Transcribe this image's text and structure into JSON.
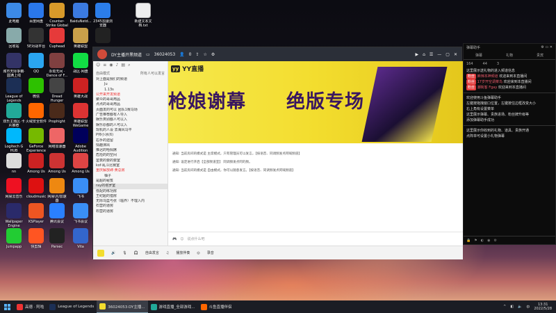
{
  "desktop": {
    "icons": [
      {
        "label": "此电脑",
        "color": "#3c8ae6"
      },
      {
        "label": "百度网盘",
        "color": "#2a77ea"
      },
      {
        "label": "Counter-Strike Global Off...",
        "color": "#d89a2a"
      },
      {
        "label": "BaiduNetd...",
        "color": "#3b7ae0"
      },
      {
        "label": "2345加速浏览器",
        "color": "#2b7de9"
      },
      {
        "label": "回收站",
        "color": "#8aa"
      },
      {
        "label": "5E对战平台",
        "color": "#333"
      },
      {
        "label": "Cuphead",
        "color": "#e63a3a"
      },
      {
        "label": "英雄联盟",
        "color": "#c9a04a"
      },
      {
        "label": "",
        "color": "#222"
      },
      {
        "label": "城市天际争霸·圆满上线",
        "color": "#336"
      },
      {
        "label": "QQ",
        "color": "#2aa5f0"
      },
      {
        "label": "永劫无间 · Dance of F...",
        "color": "#804040"
      },
      {
        "label": "战区·网盘",
        "color": "#1d4"
      },
      {
        "label": "",
        "color": "#666"
      },
      {
        "label": "League of Legends",
        "color": "#1c2f55"
      },
      {
        "label": "微信",
        "color": "#2dc100"
      },
      {
        "label": "Dread Hunger",
        "color": "#444"
      },
      {
        "label": "英雄大战",
        "color": "#c22"
      },
      {
        "label": "",
        "color": "#999"
      },
      {
        "label": "双乐主题区·卡片推荐",
        "color": "#2a9"
      },
      {
        "label": "火绒安全软件",
        "color": "#f60"
      },
      {
        "label": "Prophight",
        "color": "#4a2a1a"
      },
      {
        "label": "英雄联盟WeGame",
        "color": "#d33"
      },
      {
        "label": "",
        "color": "#555"
      },
      {
        "label": "Logitech G HUB",
        "color": "#00b8fc"
      },
      {
        "label": "GeForce Experience",
        "color": "#76b900"
      },
      {
        "label": "网络加速器",
        "color": "#e66"
      },
      {
        "label": "Adobe Audition",
        "color": "#00005b"
      },
      {
        "label": "",
        "color": "#444"
      },
      {
        "label": "nn",
        "color": "#ddd"
      },
      {
        "label": "Among Us",
        "color": "#c22"
      },
      {
        "label": "Among Us",
        "color": "#c33"
      },
      {
        "label": "Among Us",
        "color": "#d44"
      },
      {
        "label": "Among Us",
        "color": "#333"
      },
      {
        "label": "网易云音乐",
        "color": "#e12"
      },
      {
        "label": "cloudmusic",
        "color": "#d11"
      },
      {
        "label": "网易UU加速器",
        "color": "#e81"
      },
      {
        "label": "飞书",
        "color": "#3a8ef6"
      },
      {
        "label": "WPS表格",
        "color": "#2db34a"
      },
      {
        "label": "Wallpaper Engine",
        "color": "#2a2a6a"
      },
      {
        "label": "KSPlayer",
        "color": "#e52"
      },
      {
        "label": "腾讯会议",
        "color": "#2a80ff"
      },
      {
        "label": "飞书会议",
        "color": "#3a8ef6"
      },
      {
        "label": "WPS Office",
        "color": "#d22"
      },
      {
        "label": "Jumpapp",
        "color": "#2c3"
      },
      {
        "label": "快剪辑",
        "color": "#f52"
      },
      {
        "label": "Parsec",
        "color": "#222"
      },
      {
        "label": "Vita",
        "color": "#36c"
      },
      {
        "label": "PPT",
        "color": "#e55"
      }
    ],
    "file": {
      "label": "新建文本文档.txt"
    }
  },
  "app": {
    "title": "DY主播开黑频道",
    "room_id": "36024053",
    "member_count": "0",
    "left_header": "自由模式",
    "left_sub": "所有人可以发言",
    "channels": [
      {
        "label": "对上面是我们的频道",
        "cls": ""
      },
      {
        "label": "Ju",
        "cls": "sub"
      },
      {
        "label": "1.13s",
        "cls": "sub"
      },
      {
        "label": "公开来开发频道",
        "cls": "red"
      },
      {
        "label": "聚众的哥哥用品",
        "cls": ""
      },
      {
        "label": "点点的哥哥用品",
        "cls": ""
      },
      {
        "label": "页面发的可以 团队1赛马场",
        "cls": ""
      },
      {
        "label": "广告推荐都有人导入",
        "cls": ""
      },
      {
        "label": "娱乐类别都人可以入",
        "cls": ""
      },
      {
        "label": "娱乐原都的人可以入",
        "cls": ""
      },
      {
        "label": "现机的人设 去海风马平",
        "cls": ""
      },
      {
        "label": "P帅小冰(6)",
        "cls": ""
      },
      {
        "label": "右手的遗留",
        "cls": ""
      },
      {
        "label": "情趣演出",
        "cls": ""
      },
      {
        "label": "推迟的哈佩席",
        "cls": ""
      },
      {
        "label": "危险的的空间",
        "cls": ""
      },
      {
        "label": "鉴衰的要的要室",
        "cls": ""
      },
      {
        "label": "kof·乱斗比赛室",
        "cls": ""
      },
      {
        "label": "重庆解放碑·黄总房",
        "cls": "red"
      },
      {
        "label": "柚子",
        "cls": "sub"
      },
      {
        "label": "是超的秘笈",
        "cls": ""
      },
      {
        "label": "ray的塔罗室",
        "cls": "sel"
      },
      {
        "label": "低配的练功房",
        "cls": ""
      },
      {
        "label": "王纪超的猎房",
        "cls": ""
      },
      {
        "label": "无际乌篮与张（临界）不理入内",
        "cls": ""
      },
      {
        "label": "石营的道房",
        "cls": ""
      },
      {
        "label": "石营的道房",
        "cls": ""
      }
    ],
    "banner": {
      "brand": "YY直播",
      "brand_badge": "yy",
      "headline_left": "枪娘谢幕",
      "headline_right": "绝版专场"
    },
    "notices": [
      "通知: 当前房间的模式是 主席模式，只有管理员可以发言。【按语音、同调频发点阿喊频道】",
      "通知: 设定进行开启【全部频道室】 同调频发点阿的频。",
      "通知: 当前房间的模式是 自由模式，你可以随意发言。【按语音、同调频发点阿喊频道】"
    ],
    "input_placeholder": "说点什么吧",
    "bottom_items": [
      "自由发言",
      "播放伴奏",
      "录音"
    ]
  },
  "chat_panel": {
    "title": "弹幕助手",
    "tabs": [
      "弹幕",
      "礼物",
      "贵宾"
    ],
    "stats": [
      "164",
      "44",
      "3"
    ],
    "lines": [
      {
        "text": "这里展示送礼物的进入频道信息",
        "kind": "plain"
      },
      {
        "tag": "粉丝",
        "name": "麻辣本神频道",
        "text": "欢迎来到本直播间",
        "kind": "user"
      },
      {
        "tag": "粉丝",
        "name": "17岁开空调菜鸟",
        "text": "欢迎来到本直播间",
        "kind": "user"
      },
      {
        "tag": "粉丝",
        "name": "潮街客 Fgay",
        "text": "欢迎来到本直播间",
        "kind": "user"
      },
      {
        "text": "欢迎使用斗鱼弹幕助手",
        "kind": "plain"
      },
      {
        "text": "左键按拖拽窗口位置，左键按住边框改变大小",
        "kind": "plain"
      },
      {
        "text": "右上角有设置菜单",
        "kind": "plain"
      },
      {
        "text": "这里展示弹幕、贵族进场、粉丝牌升级等",
        "kind": "plain"
      },
      {
        "text": "添加弹幕助手成功",
        "kind": "plain"
      },
      {
        "text": "这里展示你收到的礼物、道具、贵族开通",
        "kind": "plain"
      },
      {
        "text": "点阵单可设置小礼物弹幕",
        "kind": "plain"
      }
    ]
  },
  "taskbar": {
    "items": [
      {
        "label": "高德 · 阿啦",
        "color": "#e33"
      },
      {
        "label": "League of Legends",
        "color": "#1c2f55"
      },
      {
        "label": "36024053·DY主播...",
        "color": "#f3dd2e"
      },
      {
        "label": "游戏直播_全部游戏...",
        "color": "#2a9"
      },
      {
        "label": "斗鱼直播伴侣",
        "color": "#f60"
      }
    ],
    "time": "13:31",
    "date": "2022/5/28"
  }
}
